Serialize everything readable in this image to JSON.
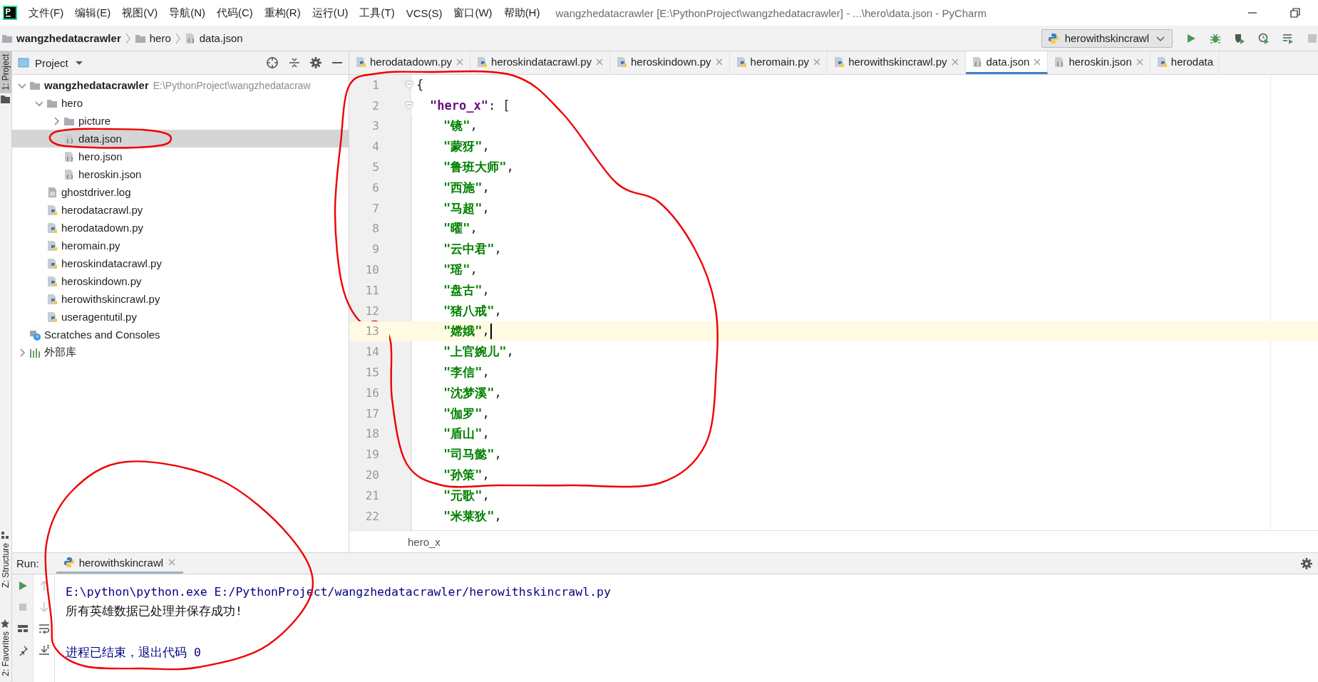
{
  "menu_bar": {
    "items": [
      "文件(F)",
      "编辑(E)",
      "视图(V)",
      "导航(N)",
      "代码(C)",
      "重构(R)",
      "运行(U)",
      "工具(T)",
      "VCS(S)",
      "窗口(W)",
      "帮助(H)"
    ],
    "title": "wangzhedatacrawler [E:\\PythonProject\\wangzhedatacrawler] - ...\\hero\\data.json - PyCharm"
  },
  "navigation_bar": {
    "breadcrumb": [
      {
        "label": "wangzhedatacrawler",
        "kind": "project"
      },
      {
        "label": "hero",
        "kind": "folder"
      },
      {
        "label": "data.json",
        "kind": "json"
      }
    ],
    "run_config": "herowithskincrawl"
  },
  "tool_stripes": {
    "top": {
      "label": "1: Project",
      "selected": true
    },
    "bottom": [
      {
        "label": "Z: Structure",
        "selected": false
      },
      {
        "label": "2: Favorites",
        "selected": false
      }
    ]
  },
  "project_panel": {
    "title": "Project",
    "tree": [
      {
        "label": "wangzhedatacrawler",
        "kind": "project",
        "path": "E:\\PythonProject\\wangzhedatacraw",
        "expanded": true,
        "selected": false,
        "children": [
          {
            "label": "hero",
            "kind": "folder",
            "expanded": true,
            "selected": false,
            "children": [
              {
                "label": "picture",
                "kind": "folder",
                "expanded": false,
                "selected": false
              },
              {
                "label": "data.json",
                "kind": "json",
                "selected": true
              },
              {
                "label": "hero.json",
                "kind": "json",
                "selected": false
              },
              {
                "label": "heroskin.json",
                "kind": "json",
                "selected": false
              }
            ]
          },
          {
            "label": "ghostdriver.log",
            "kind": "log",
            "selected": false
          },
          {
            "label": "herodatacrawl.py",
            "kind": "py",
            "selected": false
          },
          {
            "label": "herodatadown.py",
            "kind": "py",
            "selected": false
          },
          {
            "label": "heromain.py",
            "kind": "py",
            "selected": false
          },
          {
            "label": "heroskindatacrawl.py",
            "kind": "py",
            "selected": false
          },
          {
            "label": "heroskindown.py",
            "kind": "py",
            "selected": false
          },
          {
            "label": "herowithskincrawl.py",
            "kind": "py",
            "selected": false
          },
          {
            "label": "useragentutil.py",
            "kind": "py",
            "selected": false
          }
        ]
      },
      {
        "label": "Scratches and Consoles",
        "kind": "scratch",
        "selected": false
      },
      {
        "label": "外部库",
        "kind": "library",
        "expanded": false,
        "selected": false
      }
    ]
  },
  "editor": {
    "tabs": [
      {
        "label": "herodatadown.py",
        "kind": "py",
        "selected": false,
        "closable": true
      },
      {
        "label": "heroskindatacrawl.py",
        "kind": "py",
        "selected": false,
        "closable": true
      },
      {
        "label": "heroskindown.py",
        "kind": "py",
        "selected": false,
        "closable": true
      },
      {
        "label": "heromain.py",
        "kind": "py",
        "selected": false,
        "closable": true
      },
      {
        "label": "herowithskincrawl.py",
        "kind": "py",
        "selected": false,
        "closable": true
      },
      {
        "label": "data.json",
        "kind": "json",
        "selected": true,
        "closable": true
      },
      {
        "label": "heroskin.json",
        "kind": "json",
        "selected": false,
        "closable": true
      },
      {
        "label": "herodata",
        "kind": "py",
        "selected": false,
        "closable": false
      }
    ],
    "lines": [
      {
        "number": "1",
        "kind": "brace",
        "text": "{",
        "current": false
      },
      {
        "number": "2",
        "kind": "key",
        "key": "\"hero_x\"",
        "rest": ": [",
        "current": false
      },
      {
        "number": "3",
        "kind": "item",
        "value": "\"镜\"",
        "rest": ",",
        "current": false
      },
      {
        "number": "4",
        "kind": "item",
        "value": "\"蒙犽\"",
        "rest": ",",
        "current": false
      },
      {
        "number": "5",
        "kind": "item",
        "value": "\"鲁班大师\"",
        "rest": ",",
        "current": false
      },
      {
        "number": "6",
        "kind": "item",
        "value": "\"西施\"",
        "rest": ",",
        "current": false
      },
      {
        "number": "7",
        "kind": "item",
        "value": "\"马超\"",
        "rest": ",",
        "current": false
      },
      {
        "number": "8",
        "kind": "item",
        "value": "\"曜\"",
        "rest": ",",
        "current": false
      },
      {
        "number": "9",
        "kind": "item",
        "value": "\"云中君\"",
        "rest": ",",
        "current": false
      },
      {
        "number": "10",
        "kind": "item",
        "value": "\"瑶\"",
        "rest": ",",
        "current": false
      },
      {
        "number": "11",
        "kind": "item",
        "value": "\"盘古\"",
        "rest": ",",
        "current": false
      },
      {
        "number": "12",
        "kind": "item",
        "value": "\"猪八戒\"",
        "rest": ",",
        "current": false
      },
      {
        "number": "13",
        "kind": "item",
        "value": "\"嫦娥\"",
        "rest": ",",
        "current": true
      },
      {
        "number": "14",
        "kind": "item",
        "value": "\"上官婉儿\"",
        "rest": ",",
        "current": false
      },
      {
        "number": "15",
        "kind": "item",
        "value": "\"李信\"",
        "rest": ",",
        "current": false
      },
      {
        "number": "16",
        "kind": "item",
        "value": "\"沈梦溪\"",
        "rest": ",",
        "current": false
      },
      {
        "number": "17",
        "kind": "item",
        "value": "\"伽罗\"",
        "rest": ",",
        "current": false
      },
      {
        "number": "18",
        "kind": "item",
        "value": "\"盾山\"",
        "rest": ",",
        "current": false
      },
      {
        "number": "19",
        "kind": "item",
        "value": "\"司马懿\"",
        "rest": ",",
        "current": false
      },
      {
        "number": "20",
        "kind": "item",
        "value": "\"孙策\"",
        "rest": ",",
        "current": false
      },
      {
        "number": "21",
        "kind": "item",
        "value": "\"元歌\"",
        "rest": ",",
        "current": false
      },
      {
        "number": "22",
        "kind": "item",
        "value": "\"米莱狄\"",
        "rest": ",",
        "current": false
      }
    ],
    "breadcrumb": "hero_x"
  },
  "run_panel": {
    "label": "Run:",
    "tab": "herowithskincrawl",
    "output": [
      {
        "kind": "command",
        "text": "E:\\python\\python.exe E:/PythonProject/wangzhedatacrawler/herowithskincrawl.py"
      },
      {
        "kind": "stdout",
        "text": "所有英雄数据已处理并保存成功!"
      },
      {
        "kind": "system",
        "text": "进程已结束，退出代码 0"
      }
    ]
  },
  "annotations": [
    {
      "kind": "ring"
    },
    {
      "kind": "ring"
    },
    {
      "kind": "ring"
    }
  ]
}
